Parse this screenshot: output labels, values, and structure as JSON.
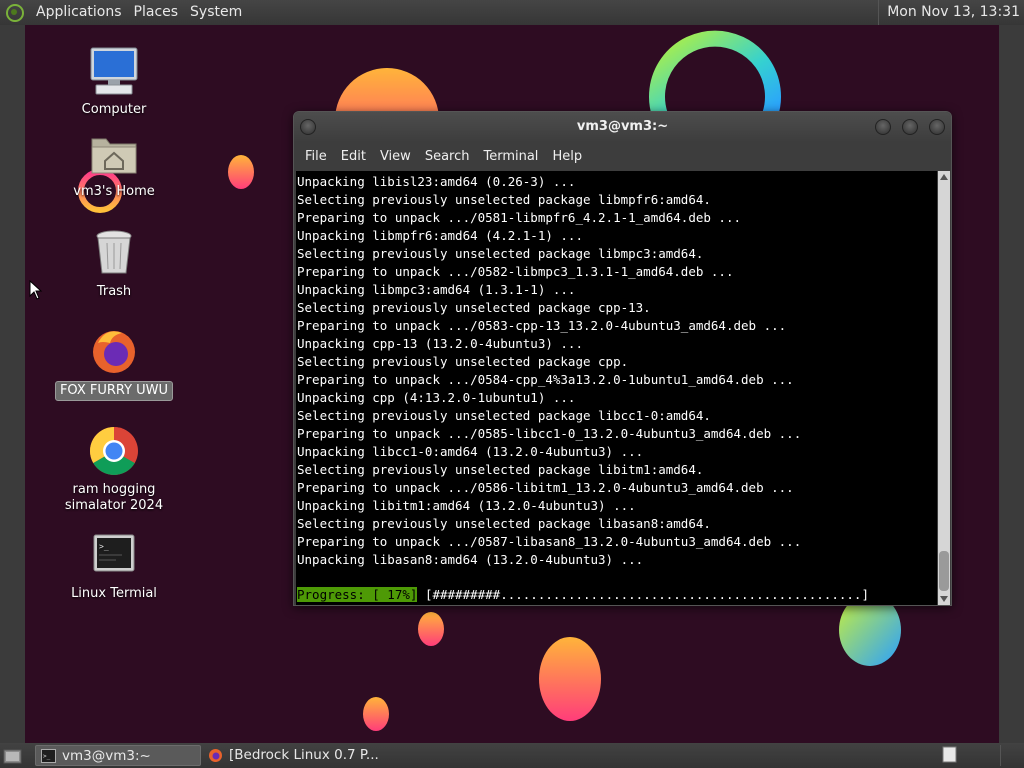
{
  "top_panel": {
    "menus": [
      "Applications",
      "Places",
      "System"
    ],
    "clock": "Mon Nov 13, 13:31"
  },
  "desktop_icons": [
    {
      "label": "Computer",
      "icon": "computer-icon"
    },
    {
      "label": "vm3's Home",
      "icon": "home-folder-icon"
    },
    {
      "label": "Trash",
      "icon": "trash-icon"
    },
    {
      "label": "FOX FURRY UWU",
      "icon": "firefox-icon",
      "selected": true
    },
    {
      "label": "ram hogging\nsimalator 2024",
      "icon": "chrome-icon"
    },
    {
      "label": "Linux Termial",
      "icon": "terminal-icon"
    }
  ],
  "terminal": {
    "title": "vm3@vm3:~",
    "menu": [
      "File",
      "Edit",
      "View",
      "Search",
      "Terminal",
      "Help"
    ],
    "lines": [
      "Unpacking libisl23:amd64 (0.26-3) ...",
      "Selecting previously unselected package libmpfr6:amd64.",
      "Preparing to unpack .../0581-libmpfr6_4.2.1-1_amd64.deb ...",
      "Unpacking libmpfr6:amd64 (4.2.1-1) ...",
      "Selecting previously unselected package libmpc3:amd64.",
      "Preparing to unpack .../0582-libmpc3_1.3.1-1_amd64.deb ...",
      "Unpacking libmpc3:amd64 (1.3.1-1) ...",
      "Selecting previously unselected package cpp-13.",
      "Preparing to unpack .../0583-cpp-13_13.2.0-4ubuntu3_amd64.deb ...",
      "Unpacking cpp-13 (13.2.0-4ubuntu3) ...",
      "Selecting previously unselected package cpp.",
      "Preparing to unpack .../0584-cpp_4%3a13.2.0-1ubuntu1_amd64.deb ...",
      "Unpacking cpp (4:13.2.0-1ubuntu1) ...",
      "Selecting previously unselected package libcc1-0:amd64.",
      "Preparing to unpack .../0585-libcc1-0_13.2.0-4ubuntu3_amd64.deb ...",
      "Unpacking libcc1-0:amd64 (13.2.0-4ubuntu3) ...",
      "Selecting previously unselected package libitm1:amd64.",
      "Preparing to unpack .../0586-libitm1_13.2.0-4ubuntu3_amd64.deb ...",
      "Unpacking libitm1:amd64 (13.2.0-4ubuntu3) ...",
      "Selecting previously unselected package libasan8:amd64.",
      "Preparing to unpack .../0587-libasan8_13.2.0-4ubuntu3_amd64.deb ...",
      "Unpacking libasan8:amd64 (13.2.0-4ubuntu3) ..."
    ],
    "progress_label": "Progress: [ 17%]",
    "progress_bar": "[#########................................................]"
  },
  "taskbar": {
    "tasks": [
      {
        "label": "vm3@vm3:~",
        "icon": "terminal-icon",
        "active": true
      },
      {
        "label": "[Bedrock Linux 0.7 P...",
        "icon": "firefox-icon",
        "active": false
      }
    ]
  },
  "colors": {
    "desktop_bg": "#2e0c22",
    "progress_green": "#4e9a06",
    "panel_bg": "#3c3c3c"
  }
}
